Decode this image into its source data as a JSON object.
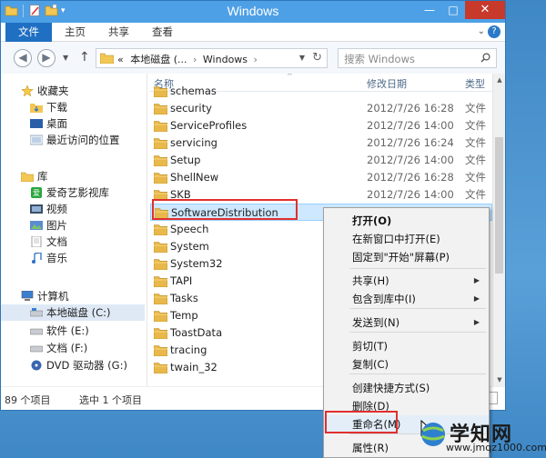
{
  "window": {
    "title": "Windows",
    "controls": {
      "minimize": "—",
      "maximize": "□",
      "close": "✕"
    }
  },
  "ribbon": {
    "tabs": [
      "文件",
      "主页",
      "共享",
      "查看"
    ]
  },
  "navbar": {
    "back": "◀",
    "forward": "▶",
    "dropdown": "▼",
    "up": "↑",
    "path_prefix": "«",
    "path": [
      "本地磁盘 (...",
      "Windows"
    ],
    "path_sep": "›",
    "refresh": "↻",
    "search_placeholder": "搜索 Windows"
  },
  "navpane": {
    "favorites_title": "收藏夹",
    "favorites": [
      "下载",
      "桌面",
      "最近访问的位置"
    ],
    "library_title": "库",
    "library": [
      "爱奇艺影视库",
      "视频",
      "图片",
      "文档",
      "音乐"
    ],
    "computer_title": "计算机",
    "drives": [
      "本地磁盘 (C:)",
      "软件 (E:)",
      "文档 (F:)",
      "DVD 驱动器 (G:)"
    ]
  },
  "filelist": {
    "headers": {
      "name": "名称",
      "date": "修改日期",
      "type": "类型"
    },
    "rows": [
      {
        "name": "schemas",
        "date": "",
        "type": ""
      },
      {
        "name": "security",
        "date": "2012/7/26 16:28",
        "type": "文件"
      },
      {
        "name": "ServiceProfiles",
        "date": "2012/7/26 14:00",
        "type": "文件"
      },
      {
        "name": "servicing",
        "date": "2012/7/26 16:24",
        "type": "文件"
      },
      {
        "name": "Setup",
        "date": "2012/7/26 14:00",
        "type": "文件"
      },
      {
        "name": "ShellNew",
        "date": "2012/7/26 16:28",
        "type": "文件"
      },
      {
        "name": "SKB",
        "date": "2012/7/26 14:00",
        "type": "文件"
      },
      {
        "name": "SoftwareDistribution",
        "date": "",
        "type": ""
      },
      {
        "name": "Speech",
        "date": "",
        "type": ""
      },
      {
        "name": "System",
        "date": "",
        "type": ""
      },
      {
        "name": "System32",
        "date": "",
        "type": ""
      },
      {
        "name": "TAPI",
        "date": "",
        "type": ""
      },
      {
        "name": "Tasks",
        "date": "",
        "type": ""
      },
      {
        "name": "Temp",
        "date": "",
        "type": ""
      },
      {
        "name": "ToastData",
        "date": "",
        "type": ""
      },
      {
        "name": "tracing",
        "date": "",
        "type": ""
      },
      {
        "name": "twain_32",
        "date": "",
        "type": ""
      }
    ]
  },
  "status": {
    "count": "89 个项目",
    "selected": "选中 1 个项目"
  },
  "context_menu": {
    "items": [
      {
        "label": "打开(O)",
        "bold": true
      },
      {
        "label": "在新窗口中打开(E)"
      },
      {
        "label": "固定到\"开始\"屏幕(P)"
      },
      {
        "label": "共享(H)",
        "submenu": true
      },
      {
        "label": "包含到库中(I)",
        "submenu": true
      },
      {
        "label": "发送到(N)",
        "submenu": true
      },
      {
        "label": "剪切(T)"
      },
      {
        "label": "复制(C)"
      },
      {
        "label": "创建快捷方式(S)"
      },
      {
        "label": "删除(D)"
      },
      {
        "label": "重命名(M)"
      },
      {
        "label": "属性(R)"
      }
    ],
    "submenu_arrow": "▶"
  },
  "watermark": {
    "title": "学知网",
    "url": "www.jmqz1000.com"
  },
  "colors": {
    "titlebar": "#4ea0e6",
    "file_tab": "#1f6fc2",
    "close": "#c7392b",
    "selection": "#cde8ff",
    "annotation": "#e02f2f",
    "folder": "#e8b84a"
  }
}
